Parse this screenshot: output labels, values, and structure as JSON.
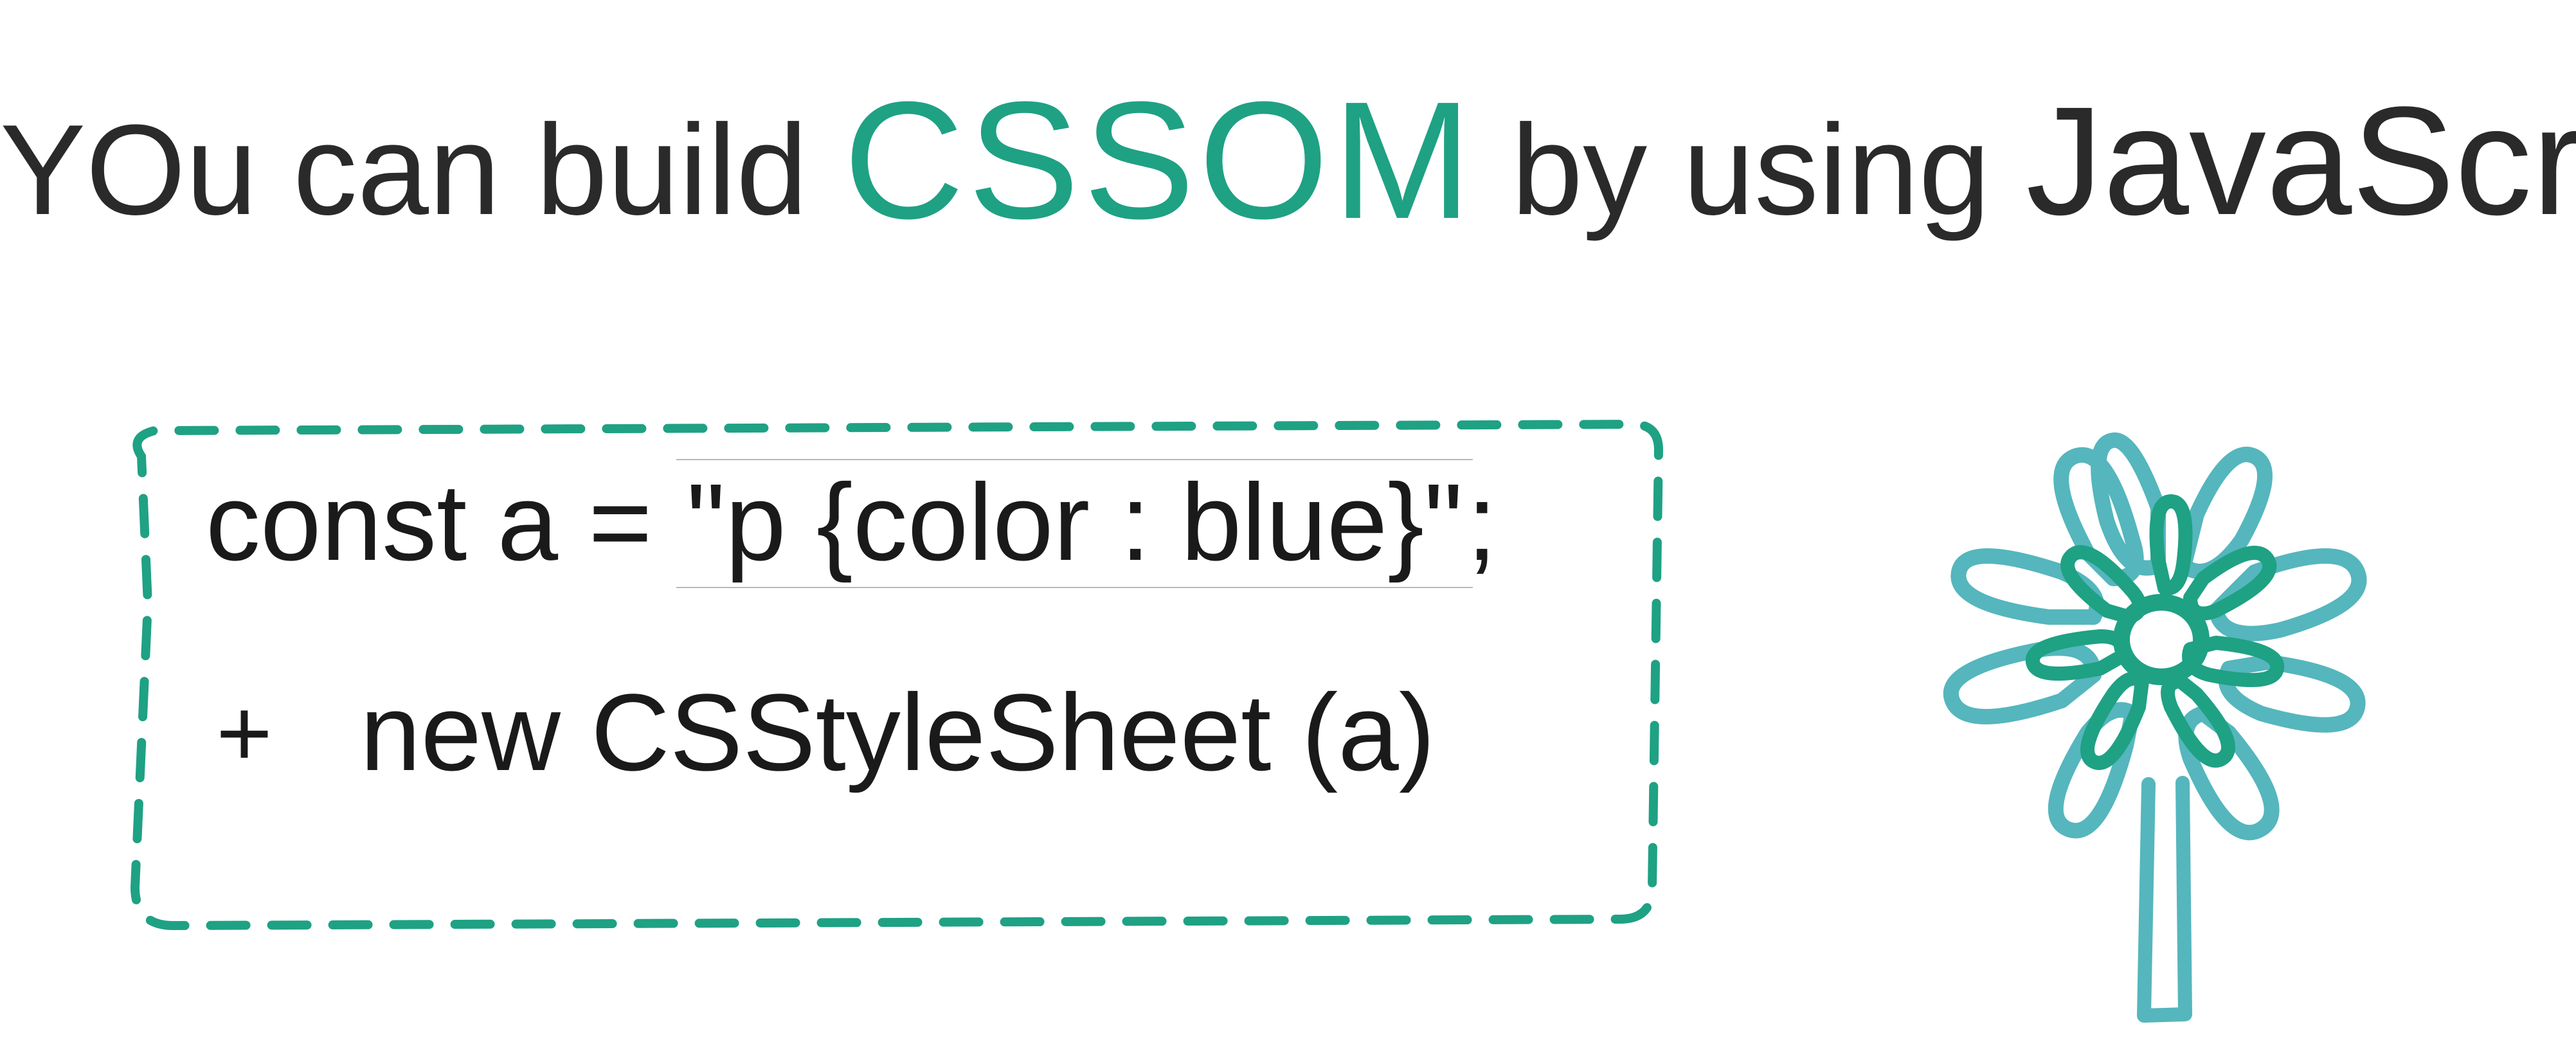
{
  "colors": {
    "accent": "#1fa184",
    "ink": "#2a2a2a",
    "flower_outer": "#55b6bd",
    "flower_inner": "#1fa184"
  },
  "headline": {
    "part1": "YOu can build ",
    "accent": "CSSOM",
    "part2": " by using ",
    "big": "JavaScript"
  },
  "codebox": {
    "line1_prefix": "const a = ",
    "line1_string": "\"p {color : blue}\"",
    "line1_suffix": ";",
    "plus": "+",
    "line2": "new CSStyleSheet (a)"
  },
  "flower_label": "flower-doodle"
}
